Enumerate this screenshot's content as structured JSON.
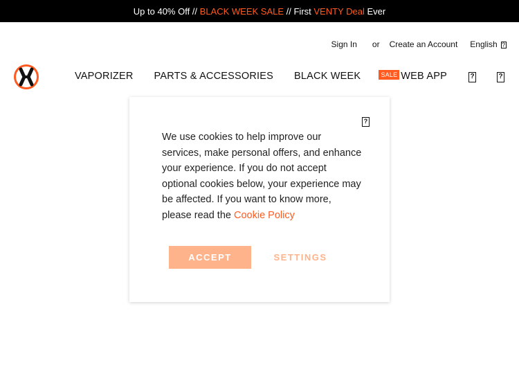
{
  "promo_bar": {
    "part1": "Up to 40% Off // ",
    "part2": "BLACK WEEK SALE",
    "part3": " // First ",
    "part4": "VENTY Deal",
    "part5": " Ever"
  },
  "header": {
    "sign_in": "Sign In",
    "or": "or",
    "create_account": "Create an Account",
    "language": "English",
    "language_icon": "?"
  },
  "nav": {
    "items": [
      "VAPORIZER",
      "PARTS & ACCESSORIES",
      "BLACK WEEK",
      "WEB APP"
    ],
    "sale_badge": "SALE"
  },
  "icons": {
    "search": "?",
    "cart": "?"
  },
  "cookie_modal": {
    "close_icon": "?",
    "text": "We use cookies to help improve our services, make personal offers, and enhance your experience. If you do not accept optional cookies below, your experience may be affected. If you want to know more, please read the ",
    "link": "Cookie Policy",
    "accept_label": "ACCEPT",
    "settings_label": "SETTINGS"
  },
  "colors": {
    "accent": "#ff5a1f",
    "accept_bg": "#ffb38a"
  }
}
